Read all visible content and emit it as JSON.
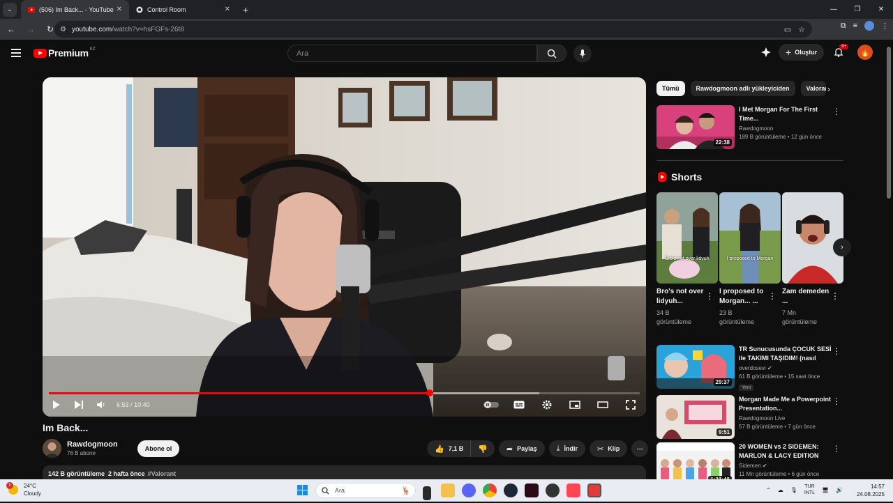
{
  "browser": {
    "tabs": [
      {
        "title": "(506) Im Back... - YouTube",
        "active": true
      },
      {
        "title": "Control Room",
        "active": false
      }
    ],
    "url_host": "youtube.com",
    "url_path": "/watch?v=hsFGFs-26t8"
  },
  "header": {
    "logo_text": "Premium",
    "country": "KZ",
    "search_placeholder": "Ara",
    "create_label": "Oluştur",
    "notif_badge": "9+"
  },
  "player": {
    "current_time": "6:53",
    "separator": "/",
    "duration": "10:40",
    "played_fraction": 0.645,
    "buffered_fraction": 0.83
  },
  "video": {
    "title": "Im Back...",
    "channel": "Rawdogmoon",
    "subs": "76 B abone",
    "subscribe_label": "Abone ol",
    "likes": "7,1 B",
    "share_label": "Paylaş",
    "download_label": "İndir",
    "clip_label": "Klip",
    "views": "142 B görüntüleme",
    "date": "2 hafta önce",
    "tag": "#Valorant"
  },
  "chips": [
    "Tümü",
    "Rawdogmoon adlı yükleyiciden",
    "Valorant"
  ],
  "recs": [
    {
      "title": "I Met Morgan For The First Time...",
      "channel": "Rawdogmoon",
      "meta": "189 B görüntüleme • 12 gün önce",
      "duration": "22:38"
    },
    {
      "title": "TR Sunucusunda ÇOCUK SESİ ile TAKIMI TAŞIDIM! (nasıl tep...",
      "channel": "overdosevi",
      "meta": "61 B görüntüleme • 15 saat önce",
      "duration": "29:37",
      "badge": "Yeni"
    },
    {
      "title": "Morgan Made Me a Powerpoint Presentation...",
      "channel": "Rawdogmoon Live",
      "meta": "57 B görüntüleme • 7 gün önce",
      "duration": "9:51"
    },
    {
      "title": "20 WOMEN vs 2 SIDEMEN: MARLON & LACY EDITION",
      "channel": "Sidemen",
      "meta": "11 Mn görüntüleme • 6 gün önce",
      "duration": "1:21:48"
    }
  ],
  "shorts": {
    "heading": "Shorts",
    "items": [
      {
        "title": "Bro's not over lidyuh...",
        "views": "34 B görüntüleme",
        "caption": "Bro's not over lidyuh"
      },
      {
        "title": "I proposed to Morgan... ...",
        "views": "23 B görüntüleme",
        "caption": "I proposed to Morgan"
      },
      {
        "title": "Zam demeden ...",
        "views": "7 Mn görüntüleme",
        "caption": ""
      }
    ]
  },
  "taskbar": {
    "temp": "24°C",
    "weather": "Cloudy",
    "weather_badge": "1",
    "search_placeholder": "Ara",
    "lang_top": "TUR",
    "lang_bottom": "INTL",
    "time": "14:57",
    "date": "24.08.2025"
  },
  "colors": {
    "accent": "#ff0000",
    "bg": "#0f0f0f",
    "chip": "#272727"
  }
}
